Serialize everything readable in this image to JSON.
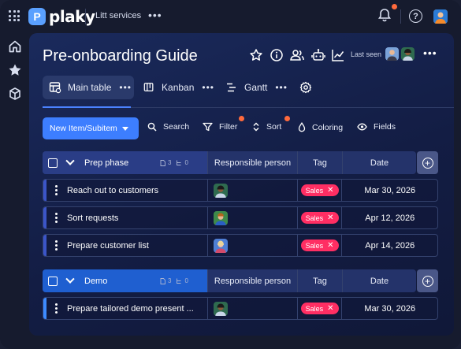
{
  "app": {
    "logo_letter": "P",
    "name": "plaky",
    "workspace": "Litt services",
    "more": "•••"
  },
  "page": {
    "title": "Pre-onboarding Guide",
    "last_seen": "Last seen",
    "more": "•••"
  },
  "tabs": [
    {
      "label": "Main table",
      "more": "•••",
      "active": true
    },
    {
      "label": "Kanban",
      "more": "•••"
    },
    {
      "label": "Gantt",
      "more": "•••"
    }
  ],
  "toolbar": {
    "new_item": "New Item/Subitem",
    "search": "Search",
    "filter": "Filter",
    "sort": "Sort",
    "coloring": "Coloring",
    "fields": "Fields"
  },
  "groups": [
    {
      "name": "Prep phase",
      "files": "3",
      "subitems": "0",
      "columns": {
        "person": "Responsible person",
        "tag": "Tag",
        "date": "Date"
      },
      "accent": "#3b55c8",
      "rows": [
        {
          "name": "Reach out to customers",
          "tag": "Sales",
          "date": "Mar 30, 2026",
          "avatar_color": "#2f6b4f"
        },
        {
          "name": "Sort requests",
          "tag": "Sales",
          "date": "Apr 12, 2026",
          "avatar_color": "#3e8a4a"
        },
        {
          "name": "Prepare customer list",
          "tag": "Sales",
          "date": "Apr 14, 2026",
          "avatar_color": "#4f7fd6"
        }
      ]
    },
    {
      "name": "Demo",
      "files": "3",
      "subitems": "0",
      "columns": {
        "person": "Responsible person",
        "tag": "Tag",
        "date": "Date"
      },
      "accent": "#3d8bff",
      "rows": [
        {
          "name": "Prepare tailored demo present ...",
          "tag": "Sales",
          "date": "Mar 30, 2026",
          "avatar_color": "#2f6b4f"
        }
      ]
    }
  ],
  "tag_remove": "✕",
  "add_column": "+",
  "colors": {
    "primary": "#3d7eff",
    "tag": "#ff2e63",
    "notification": "#ff6a3d"
  }
}
